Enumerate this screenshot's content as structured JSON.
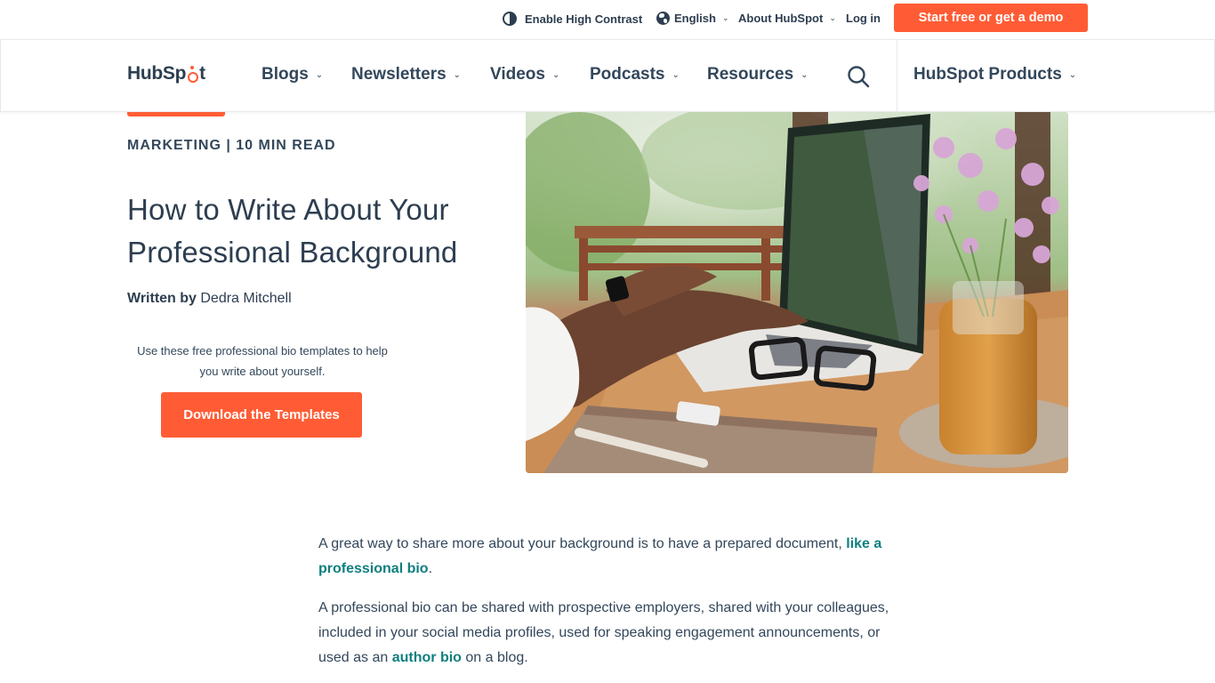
{
  "utility": {
    "high_contrast": "Enable High Contrast",
    "language": "English",
    "about": "About HubSpot",
    "login": "Log in",
    "cta": "Start free or get a demo"
  },
  "nav": {
    "logo_left": "HubSp",
    "logo_right": "t",
    "items": [
      {
        "label": "Blogs"
      },
      {
        "label": "Newsletters"
      },
      {
        "label": "Videos"
      },
      {
        "label": "Podcasts"
      },
      {
        "label": "Resources"
      }
    ],
    "products": "HubSpot Products",
    "chevron": "⌄"
  },
  "hero": {
    "eyebrow": "MARKETING | 10 MIN READ",
    "title": "How to Write About Your Professional Background",
    "byline_prefix": "Written by ",
    "author": "Dedra Mitchell",
    "promo_text": "Use these free professional bio templates to help you write about yourself.",
    "download_button": "Download the Templates",
    "image_alt": "Person typing on a laptop at a wooden desk with glasses, notebook, flowers and a mug"
  },
  "article": {
    "p1_text": "A great way to share more about your background is to have a prepared document, ",
    "p1_link": "like a professional bio",
    "p1_end": ".",
    "p2_text": "A professional bio can be shared with prospective employers, shared with your colleagues, included in your social media profiles, used for speaking engagement announcements, or used as an ",
    "p2_link": "author bio",
    "p2_end": " on a blog."
  },
  "colors": {
    "accent": "#ff5c35",
    "text": "#33475b",
    "link": "#0f7f7f"
  }
}
